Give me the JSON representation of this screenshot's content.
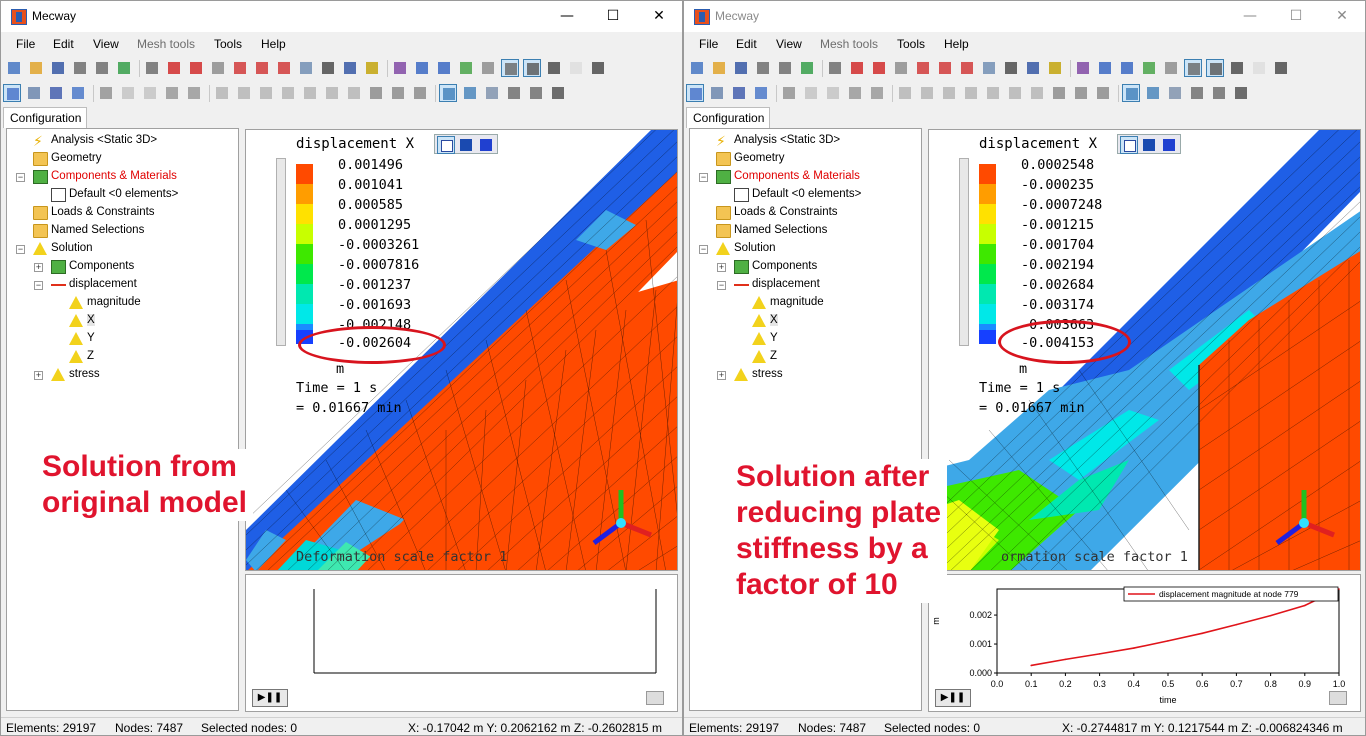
{
  "app_title": "Mecway",
  "menu": [
    "File",
    "Edit",
    "View",
    "Mesh tools",
    "Tools",
    "Help"
  ],
  "config_tab": "Configuration",
  "tree": {
    "analysis": "Analysis <Static 3D>",
    "geometry": "Geometry",
    "components": "Components & Materials",
    "default": "Default <0 elements>",
    "loads": "Loads & Constraints",
    "named": "Named Selections",
    "solution": "Solution",
    "sol_components": "Components",
    "displacement": "displacement",
    "magnitude": "magnitude",
    "x": "X",
    "y": "Y",
    "z": "Z",
    "stress": "stress"
  },
  "window_controls": {
    "minimize": "—",
    "maximize": "☐",
    "close": "✕"
  },
  "left": {
    "legend_title": "displacement X",
    "legend_values": [
      "0.001496",
      "0.001041",
      "0.000585",
      "0.0001295",
      "-0.0003261",
      "-0.0007816",
      "-0.001237",
      "-0.001693",
      "-0.002148",
      "-0.002604"
    ],
    "unit": "m",
    "time1": "Time = 1 s",
    "time2": "= 0.01667 min",
    "deform": "Deformation scale factor 1",
    "annotation": "Solution from\noriginal model",
    "status": {
      "elements": "Elements: 29197",
      "nodes": "Nodes: 7487",
      "selected": "Selected nodes: 0",
      "coords": "X: -0.17042 m Y: 0.2062162 m Z: -0.2602815 m"
    }
  },
  "right": {
    "legend_title": "displacement X",
    "legend_values": [
      "0.0002548",
      "-0.000235",
      "-0.0007248",
      "-0.001215",
      "-0.001704",
      "-0.002194",
      "-0.002684",
      "-0.003174",
      "-0.003663",
      "-0.004153"
    ],
    "unit": "m",
    "time1": "Time = 1 s",
    "time2": "= 0.01667 min",
    "deform": "ormation scale factor 1",
    "annotation": "Solution after\nreducing plate\nstiffness by a\nfactor of 10",
    "status": {
      "elements": "Elements: 29197",
      "nodes": "Nodes: 7487",
      "selected": "Selected nodes: 0",
      "coords": "X: -0.2744817 m Y: 0.1217544 m Z: -0.006824346 m"
    }
  },
  "legend_colors": [
    "#ff4a00",
    "#ff9d00",
    "#ffe100",
    "#c8ff00",
    "#3ee800",
    "#00e84c",
    "#00e8b0",
    "#00e8e8",
    "#1a8cff",
    "#1640ff"
  ],
  "chart_data": {
    "type": "line",
    "series": [
      {
        "name": "displacement magnitude at node 779",
        "x": [
          0.1,
          0.2,
          0.3,
          0.4,
          0.5,
          0.6,
          0.7,
          0.8,
          0.9,
          1.0
        ],
        "values": [
          0.00026,
          0.00047,
          0.00066,
          0.00086,
          0.00111,
          0.00137,
          0.00167,
          0.00198,
          0.00233,
          0.0029
        ]
      }
    ],
    "xlabel": "time",
    "ylabel": "m",
    "xticks": [
      "0.0",
      "0.1",
      "0.2",
      "0.3",
      "0.4",
      "0.5",
      "0.6",
      "0.7",
      "0.8",
      "0.9",
      "1.0"
    ],
    "yticks": [
      "0.000",
      "0.001",
      "0.002"
    ],
    "xlim": [
      0,
      1
    ],
    "ylim": [
      0,
      0.0029
    ],
    "line_color": "#e0141a",
    "legend_position": "top-right"
  }
}
